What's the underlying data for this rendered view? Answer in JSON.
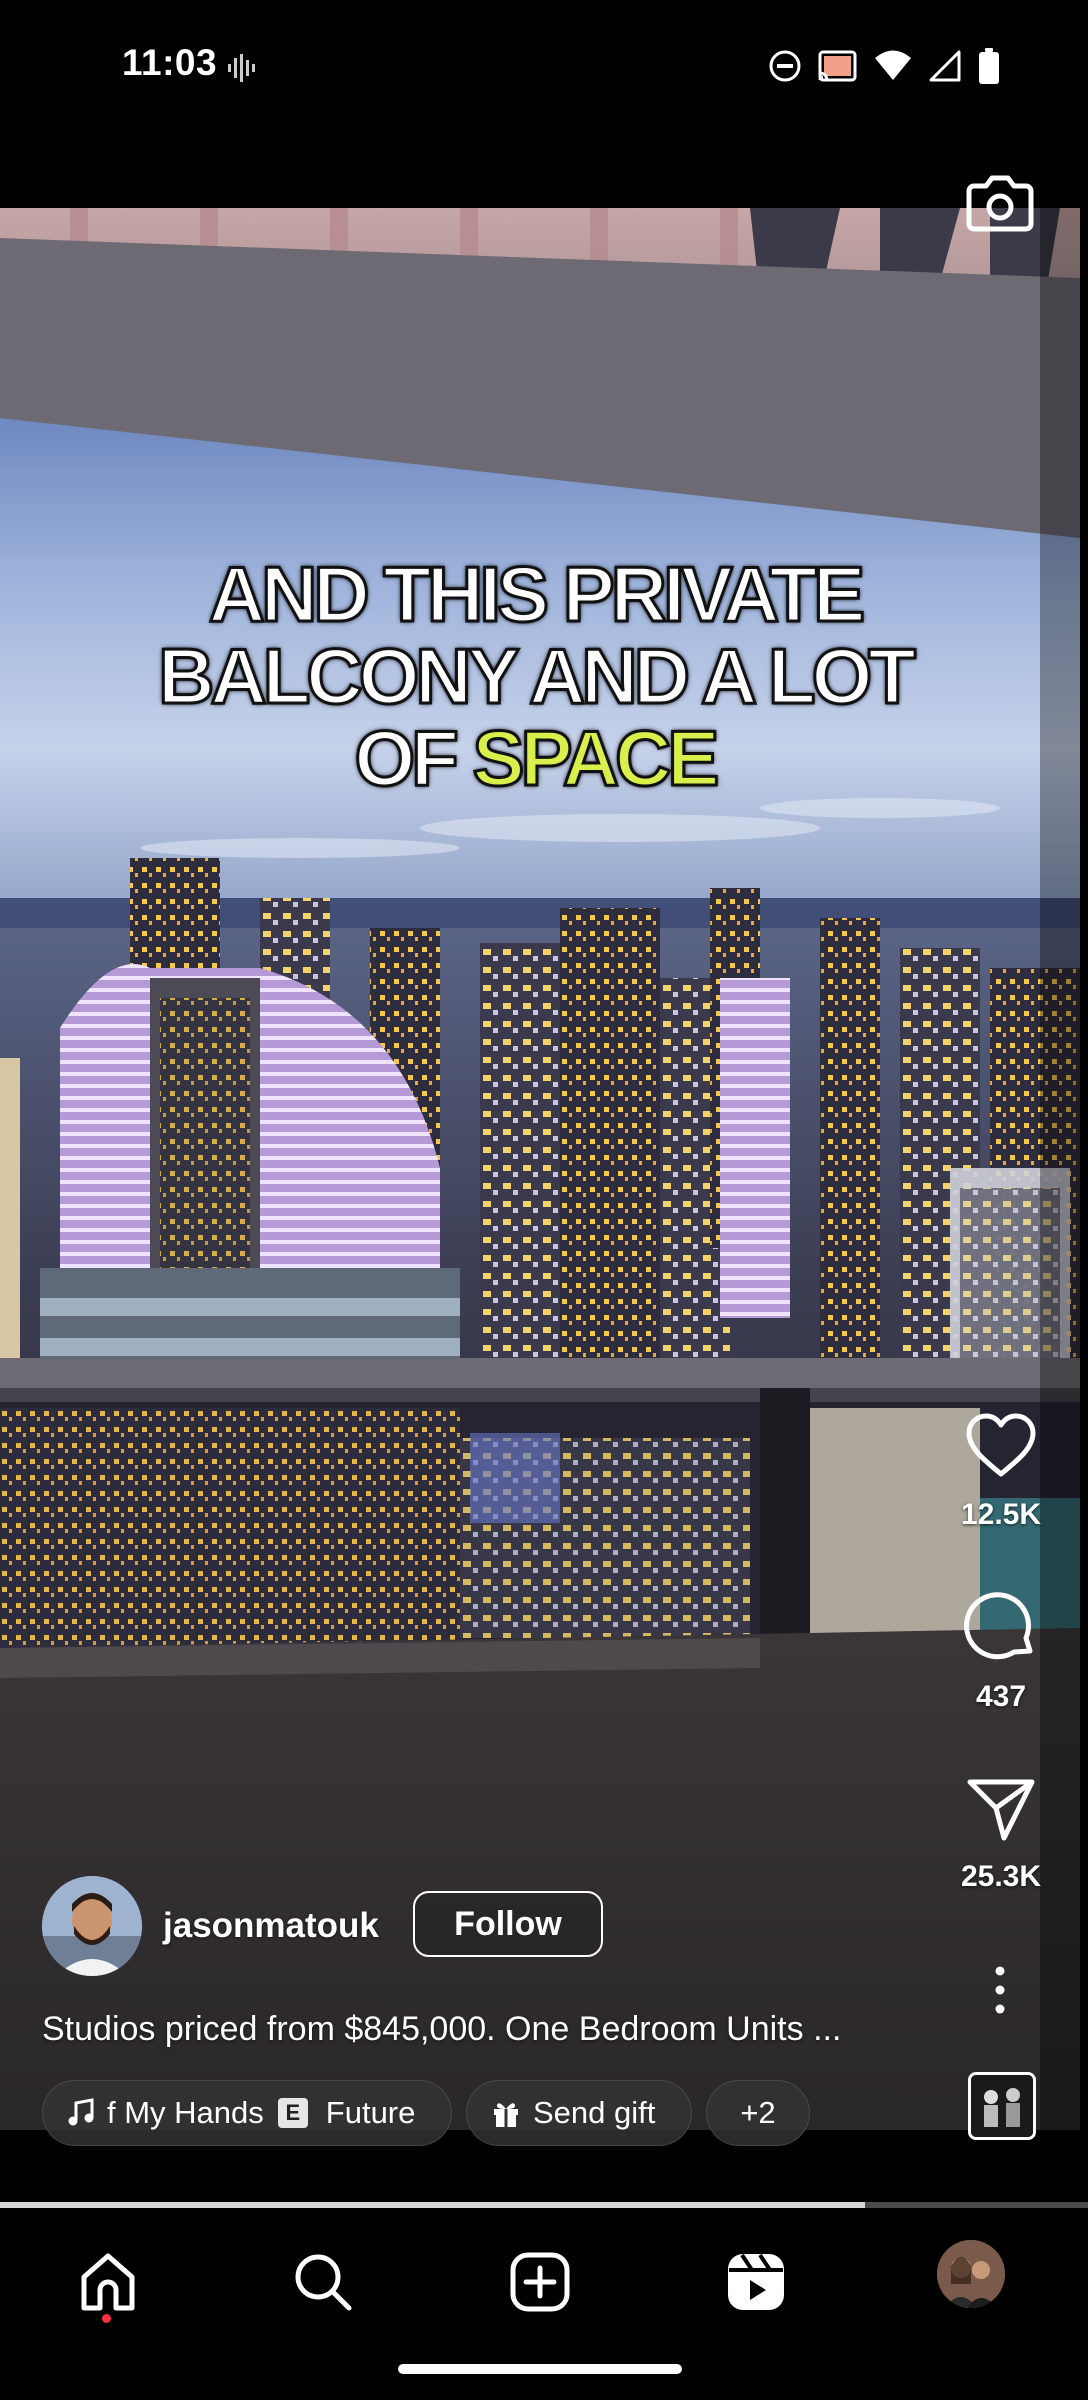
{
  "status_bar": {
    "time": "11:03",
    "icons": [
      "voice-activity-icon",
      "do-not-disturb-icon",
      "cast-icon",
      "wifi-icon",
      "signal-icon",
      "battery-icon"
    ]
  },
  "reel": {
    "overlay_caption_line1": "AND THIS PRIVATE",
    "overlay_caption_line2": "BALCONY AND A LOT",
    "overlay_caption_line3_plain": "OF ",
    "overlay_caption_line3_highlight": "SPACE",
    "highlight_color": "#d9ef4b",
    "author": {
      "username": "jasonmatouk",
      "follow_label": "Follow"
    },
    "caption": "Studios priced from $845,000. One Bedroom Units ...",
    "chips": {
      "music_title": "f My Hands",
      "explicit_badge": "E",
      "music_artist": "Future",
      "gift_label": "Send gift",
      "more_label": "+2"
    },
    "actions": {
      "likes": "12.5K",
      "comments": "437",
      "shares": "25.3K"
    },
    "progress_fraction": 0.795
  },
  "nav": {
    "items": [
      "home-icon",
      "search-icon",
      "create-icon",
      "reels-icon",
      "profile-avatar"
    ]
  }
}
